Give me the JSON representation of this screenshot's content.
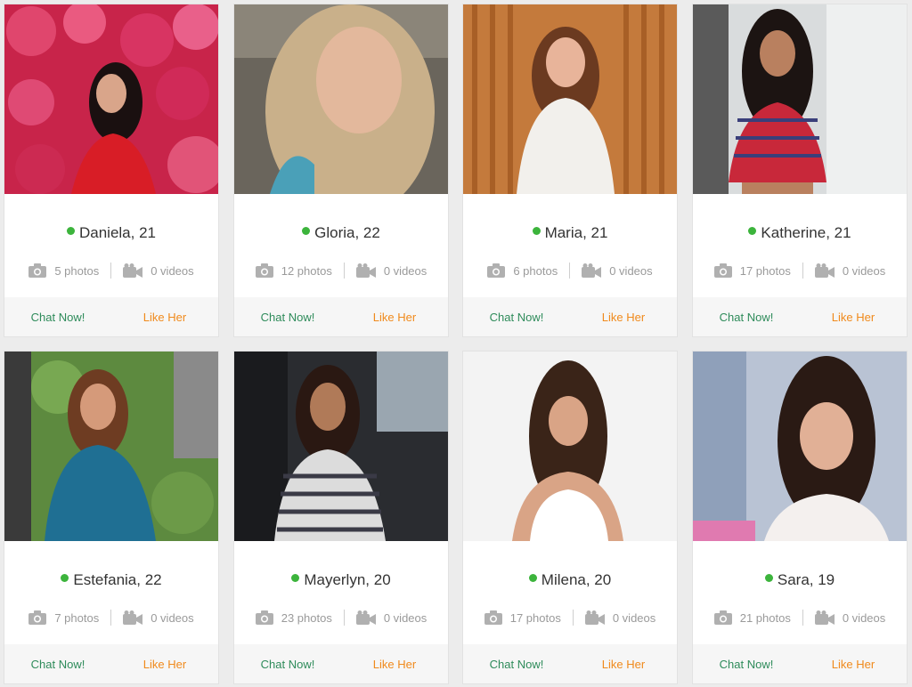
{
  "profiles": [
    {
      "name": "Daniela, 21",
      "photos": "5 photos",
      "videos": "0 videos",
      "chat": "Chat Now!",
      "like": "Like Her"
    },
    {
      "name": "Gloria, 22",
      "photos": "12 photos",
      "videos": "0 videos",
      "chat": "Chat Now!",
      "like": "Like Her"
    },
    {
      "name": "Maria, 21",
      "photos": "6 photos",
      "videos": "0 videos",
      "chat": "Chat Now!",
      "like": "Like Her"
    },
    {
      "name": "Katherine, 21",
      "photos": "17 photos",
      "videos": "0 videos",
      "chat": "Chat Now!",
      "like": "Like Her"
    },
    {
      "name": "Estefania, 22",
      "photos": "7 photos",
      "videos": "0 videos",
      "chat": "Chat Now!",
      "like": "Like Her"
    },
    {
      "name": "Mayerlyn, 20",
      "photos": "23 photos",
      "videos": "0 videos",
      "chat": "Chat Now!",
      "like": "Like Her"
    },
    {
      "name": "Milena, 20",
      "photos": "17 photos",
      "videos": "0 videos",
      "chat": "Chat Now!",
      "like": "Like Her"
    },
    {
      "name": "Sara, 19",
      "photos": "21 photos",
      "videos": "0 videos",
      "chat": "Chat Now!",
      "like": "Like Her"
    }
  ],
  "colors": {
    "online": "#3cb43c",
    "chat": "#2e8b5a",
    "like": "#f08a1c",
    "text": "#333333",
    "muted": "#9a9a9a"
  },
  "icons": {
    "photos": "camera-icon",
    "videos": "video-camera-icon",
    "status": "online-dot-icon"
  }
}
